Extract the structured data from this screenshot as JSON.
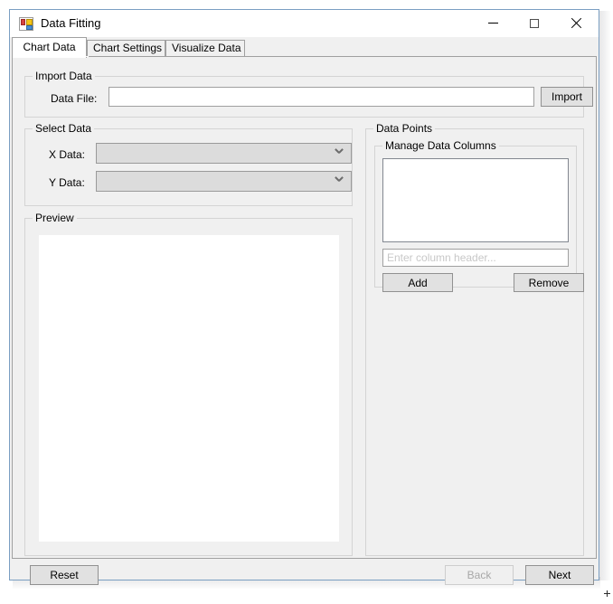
{
  "window": {
    "title": "Data Fitting",
    "icon": "winforms-app-icon",
    "controls": {
      "minimize": "minimize-icon",
      "maximize": "maximize-icon",
      "close": "close-icon"
    }
  },
  "tabs": [
    {
      "label": "Chart Data",
      "selected": true
    },
    {
      "label": "Chart Settings",
      "selected": false
    },
    {
      "label": "Visualize Data",
      "selected": false
    }
  ],
  "import_data": {
    "group_label": "Import Data",
    "file_label": "Data File:",
    "file_value": "",
    "file_placeholder": "",
    "import_button": "Import"
  },
  "select_data": {
    "group_label": "Select Data",
    "x_label": "X Data:",
    "x_value": "",
    "y_label": "Y Data:",
    "y_value": ""
  },
  "preview": {
    "group_label": "Preview",
    "content": ""
  },
  "data_points": {
    "group_label": "Data Points",
    "manage_label": "Manage Data Columns",
    "columns": [],
    "header_input_value": "",
    "header_input_placeholder": "Enter column header...",
    "add_button": "Add",
    "remove_button": "Remove"
  },
  "footer": {
    "reset_button": "Reset",
    "back_button": "Back",
    "back_enabled": false,
    "next_button": "Next",
    "next_enabled": true
  },
  "colors": {
    "window_border": "#7a9ec2",
    "form_background": "#f0f0f0",
    "control_background": "#e1e1e1",
    "disabled_text": "#a7a7a7",
    "placeholder_text": "#c8c8c8",
    "field_background": "#ffffff"
  }
}
